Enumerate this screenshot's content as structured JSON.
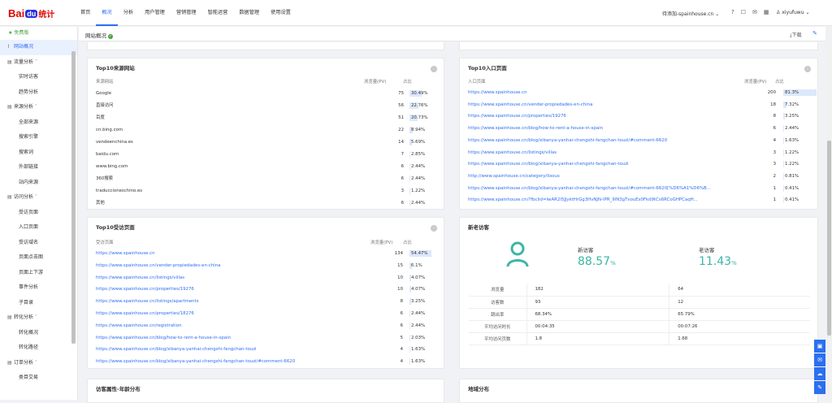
{
  "nav": [
    "首页",
    "概况",
    "分析",
    "用户管理",
    "营销管理",
    "智能运营",
    "数据管理",
    "使用设置"
  ],
  "site": "待添加-spainhouse.cn",
  "user": "xiyufuwu",
  "logo": "Baidu统计",
  "sidebar": {
    "free": "免费版",
    "items": [
      {
        "label": "网站概况",
        "group": true,
        "active": true
      },
      {
        "label": "流量分析",
        "group": true
      },
      {
        "label": "实时访客"
      },
      {
        "label": "趋势分析"
      },
      {
        "label": "来源分析",
        "group": true
      },
      {
        "label": "全部来源"
      },
      {
        "label": "搜索引擎"
      },
      {
        "label": "搜索词"
      },
      {
        "label": "外部链接"
      },
      {
        "label": "站内来源"
      },
      {
        "label": "访问分析",
        "group": true
      },
      {
        "label": "受访页面"
      },
      {
        "label": "入口页面"
      },
      {
        "label": "受访域名"
      },
      {
        "label": "页面点击图"
      },
      {
        "label": "页面上下游"
      },
      {
        "label": "事件分析"
      },
      {
        "label": "子目录"
      },
      {
        "label": "转化分析",
        "group": true
      },
      {
        "label": "转化概况"
      },
      {
        "label": "转化路径"
      },
      {
        "label": "订单分析",
        "group": true
      },
      {
        "label": "类目交易"
      }
    ]
  },
  "subheader": {
    "title": "网站概况",
    "download": "下载"
  },
  "sources": {
    "title": "Top10来源网站",
    "headers": [
      "来源网站",
      "浏览量(PV)",
      "占比"
    ],
    "rows": [
      {
        "name": "Google",
        "pv": "75",
        "pct": "30.49%",
        "ratio": 0.3049
      },
      {
        "name": "直接访问",
        "pv": "56",
        "pct": "22.76%",
        "ratio": 0.2276
      },
      {
        "name": "百度",
        "pv": "51",
        "pct": "20.73%",
        "ratio": 0.2073
      },
      {
        "name": "cn.bing.com",
        "pv": "22",
        "pct": "8.94%",
        "ratio": 0.0894
      },
      {
        "name": "vendeenchina.es",
        "pv": "14",
        "pct": "5.69%",
        "ratio": 0.0569
      },
      {
        "name": "baidu.com",
        "pv": "7",
        "pct": "2.85%",
        "ratio": 0.0285
      },
      {
        "name": "www.bing.com",
        "pv": "6",
        "pct": "2.44%",
        "ratio": 0.0244
      },
      {
        "name": "360搜索",
        "pv": "6",
        "pct": "2.44%",
        "ratio": 0.0244
      },
      {
        "name": "traduccioneschino.es",
        "pv": "3",
        "pct": "1.22%",
        "ratio": 0.0122
      },
      {
        "name": "其他",
        "pv": "6",
        "pct": "2.44%",
        "ratio": 0.0244
      }
    ]
  },
  "entries": {
    "title": "Top10入口页面",
    "headers": [
      "入口页面",
      "浏览量(PV)",
      "占比"
    ],
    "rows": [
      {
        "name": "https://www.spainhouse.cn",
        "pv": "200",
        "pct": "81.3%",
        "ratio": 0.813
      },
      {
        "name": "https://www.spainhouse.cn/vender-propiedades-en-china",
        "pv": "18",
        "pct": "7.32%",
        "ratio": 0.0732
      },
      {
        "name": "https://www.spainhouse.cn/properties/19276",
        "pv": "8",
        "pct": "3.25%",
        "ratio": 0.0325
      },
      {
        "name": "https://www.spainhouse.cn/blog/how-to-rent-a-house-in-spain",
        "pv": "6",
        "pct": "2.44%",
        "ratio": 0.0244
      },
      {
        "name": "https://www.spainhouse.cn/blog/xibanya-yanhai-chengshi-fangchan-touzi/#comment-6620",
        "pv": "4",
        "pct": "1.63%",
        "ratio": 0.0163
      },
      {
        "name": "https://www.spainhouse.cn/listings/villas",
        "pv": "3",
        "pct": "1.22%",
        "ratio": 0.0122
      },
      {
        "name": "https://www.spainhouse.cn/blog/xibanya-yanhai-chengshi-fangchan-touzi",
        "pv": "3",
        "pct": "1.22%",
        "ratio": 0.0122
      },
      {
        "name": "http://www.spainhouse.cn/category/lixous",
        "pv": "2",
        "pct": "0.81%",
        "ratio": 0.0081
      },
      {
        "name": "https://www.spainhouse.cn/blog/xibanya-yanhai-chengshi-fangchan-touzi/#comment-6620[%D6%A1%D6%B...",
        "pv": "1",
        "pct": "0.41%",
        "ratio": 0.0041
      },
      {
        "name": "https://www.spainhouse.cn/?fbclid=IwAR2l5JJyktHrGg3HvNJN-IPR_9lN3gTvouEs0Fkd9tCs6RCoGHPCaqH...",
        "pv": "1",
        "pct": "0.41%",
        "ratio": 0.0041
      }
    ]
  },
  "visited": {
    "title": "Top10受访页面",
    "headers": [
      "受访页面",
      "浏览量(PV)",
      "占比"
    ],
    "rows": [
      {
        "name": "https://www.spainhouse.cn",
        "pv": "134",
        "pct": "54.47%",
        "ratio": 0.5447
      },
      {
        "name": "https://www.spainhouse.cn/vender-propiedades-en-china",
        "pv": "15",
        "pct": "6.1%",
        "ratio": 0.061
      },
      {
        "name": "https://www.spainhouse.cn/listings/villas",
        "pv": "10",
        "pct": "4.07%",
        "ratio": 0.0407
      },
      {
        "name": "https://www.spainhouse.cn/properties/19276",
        "pv": "10",
        "pct": "4.07%",
        "ratio": 0.0407
      },
      {
        "name": "https://www.spainhouse.cn/listings/apartments",
        "pv": "8",
        "pct": "3.25%",
        "ratio": 0.0325
      },
      {
        "name": "https://www.spainhouse.cn/properties/18276",
        "pv": "6",
        "pct": "2.44%",
        "ratio": 0.0244
      },
      {
        "name": "https://www.spainhouse.cn/registration",
        "pv": "6",
        "pct": "2.44%",
        "ratio": 0.0244
      },
      {
        "name": "https://www.spainhouse.cn/blog/how-to-rent-a-house-in-spain",
        "pv": "5",
        "pct": "2.03%",
        "ratio": 0.0203
      },
      {
        "name": "https://www.spainhouse.cn/blog/xibanya-yanhai-chengshi-fangchan-touzi",
        "pv": "4",
        "pct": "1.63%",
        "ratio": 0.0163
      },
      {
        "name": "https://www.spainhouse.cn/blog/xibanya-yanhai-chengshi-fangchan-touzi/#comment-6620",
        "pv": "4",
        "pct": "1.63%",
        "ratio": 0.0163
      }
    ]
  },
  "visitors": {
    "title": "新老访客",
    "new_label": "新访客",
    "new_pct": "88.57",
    "old_label": "老访客",
    "old_pct": "11.43",
    "pct_unit": "%",
    "rows": [
      {
        "k": "浏览量",
        "new": "182",
        "old": "64"
      },
      {
        "k": "访客数",
        "new": "93",
        "old": "12"
      },
      {
        "k": "跳出率",
        "new": "68.34%",
        "old": "65.79%"
      },
      {
        "k": "平均访问时长",
        "new": "00:04:35",
        "old": "00:07:26"
      },
      {
        "k": "平均访问页数",
        "new": "1.8",
        "old": "1.68"
      }
    ]
  },
  "bottom": {
    "left": "访客属性-年龄分布",
    "right": "地域分布"
  },
  "colors": {
    "accent": "#2c6ff0",
    "green": "#3bb6a6",
    "bar": "#dce8fb",
    "brand_red": "#e10601"
  }
}
